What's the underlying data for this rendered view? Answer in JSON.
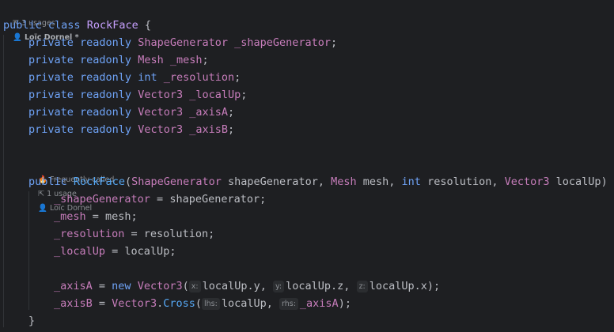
{
  "header_meta": {
    "usages": "3 usages",
    "author": "Loïc Dornel *"
  },
  "class_decl": {
    "kw_public": "public",
    "kw_class": "class",
    "name": "RockFace",
    "brace": " {"
  },
  "fields": [
    {
      "mod": "private readonly",
      "type": "ShapeGenerator",
      "name": "_shapeGenerator"
    },
    {
      "mod": "private readonly",
      "type": "Mesh",
      "name": "_mesh"
    },
    {
      "mod": "private readonly",
      "type": "int",
      "name": "_resolution"
    },
    {
      "mod": "private readonly",
      "type": "Vector3",
      "name": "_localUp"
    },
    {
      "mod": "private readonly",
      "type": "Vector3",
      "name": "_axisA"
    },
    {
      "mod": "private readonly",
      "type": "Vector3",
      "name": "_axisB"
    }
  ],
  "ctor_meta": {
    "frequently_called": "Frequently called",
    "usages": "1 usage",
    "author": "Loïc Dornel"
  },
  "ctor": {
    "kw_public": "public",
    "name": "RockFace",
    "p1_type": "ShapeGenerator",
    "p1_name": "shapeGenerator",
    "p2_type": "Mesh",
    "p2_name": "mesh",
    "p3_type": "int",
    "p3_name": "resolution",
    "p4_type": "Vector3",
    "p4_name": "localUp"
  },
  "body": {
    "a1_field": "_shapeGenerator",
    "a1_value": "shapeGenerator",
    "a2_field": "_mesh",
    "a2_value": "mesh",
    "a3_field": "_resolution",
    "a3_value": "resolution",
    "a4_field": "_localUp",
    "a4_value": "localUp",
    "axisA_field": "_axisA",
    "kw_new": "new",
    "vector3": "Vector3",
    "hint_x": "x:",
    "arg_x": "localUp.y",
    "hint_y": "y:",
    "arg_y": "localUp.z",
    "hint_z": "z:",
    "arg_z": "localUp.x",
    "axisB_field": "_axisB",
    "cross_class": "Vector3",
    "cross_method": "Cross",
    "hint_lhs": "lhs:",
    "arg_lhs": "localUp",
    "hint_rhs": "rhs:",
    "arg_rhs": "_axisA",
    "close_brace": "}"
  },
  "icons": {
    "usages": "usages-arrow-icon",
    "author": "person-icon",
    "hot": "flame-icon"
  }
}
